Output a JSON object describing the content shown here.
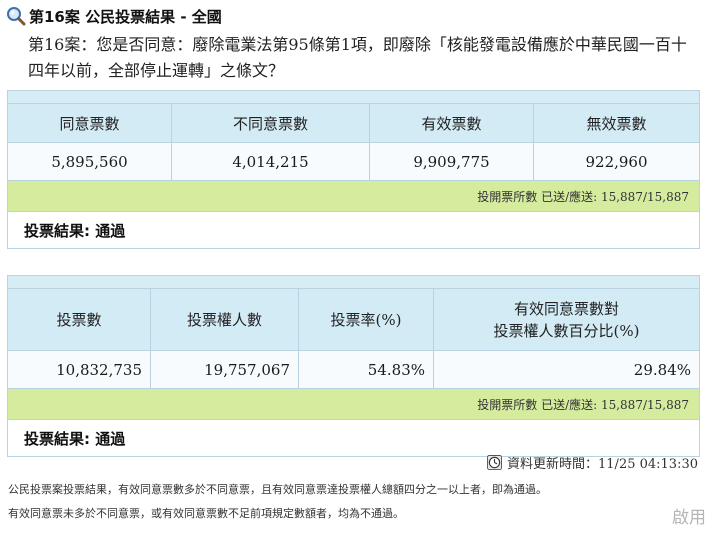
{
  "header": {
    "title": "第16案 公民投票結果 - 全國",
    "question": "第16案：您是否同意：廢除電業法第95條第1項，即廢除「核能發電設備應於中華民國一百十四年以前，全部停止運轉」之條文？"
  },
  "table1": {
    "headers": [
      "同意票數",
      "不同意票數",
      "有效票數",
      "無效票數"
    ],
    "values": [
      "5,895,560",
      "4,014,215",
      "9,909,775",
      "922,960"
    ],
    "progress": "投開票所數 已送/應送: 15,887/15,887",
    "result": "投票結果: 通過"
  },
  "table2": {
    "headers": [
      "投票數",
      "投票權人數",
      "投票率(%)"
    ],
    "header4_line1": "有效同意票數對",
    "header4_line2": "投票權人數百分比(%)",
    "values": [
      "10,832,735",
      "19,757,067",
      "54.83%",
      "29.84%"
    ],
    "progress": "投開票所數 已送/應送: 15,887/15,887",
    "result": "投票結果: 通過"
  },
  "footer": {
    "update_time": "資料更新時間：11/25 04:13:30",
    "note1": "公民投票案投票結果，有效同意票數多於不同意票，且有效同意票達投票權人總額四分之一以上者，即為通過。",
    "note2": "有效同意票未多於不同意票，或有效同意票數不足前項規定數額者，均為不通過。",
    "corner_text": "啟用"
  },
  "icons": {
    "title_icon": "search-icon",
    "update_icon": "clock-icon"
  },
  "colors": {
    "header_cell": "#d3ebf4",
    "progress_row": "#d5ec9e",
    "border": "#b9d3e2"
  }
}
